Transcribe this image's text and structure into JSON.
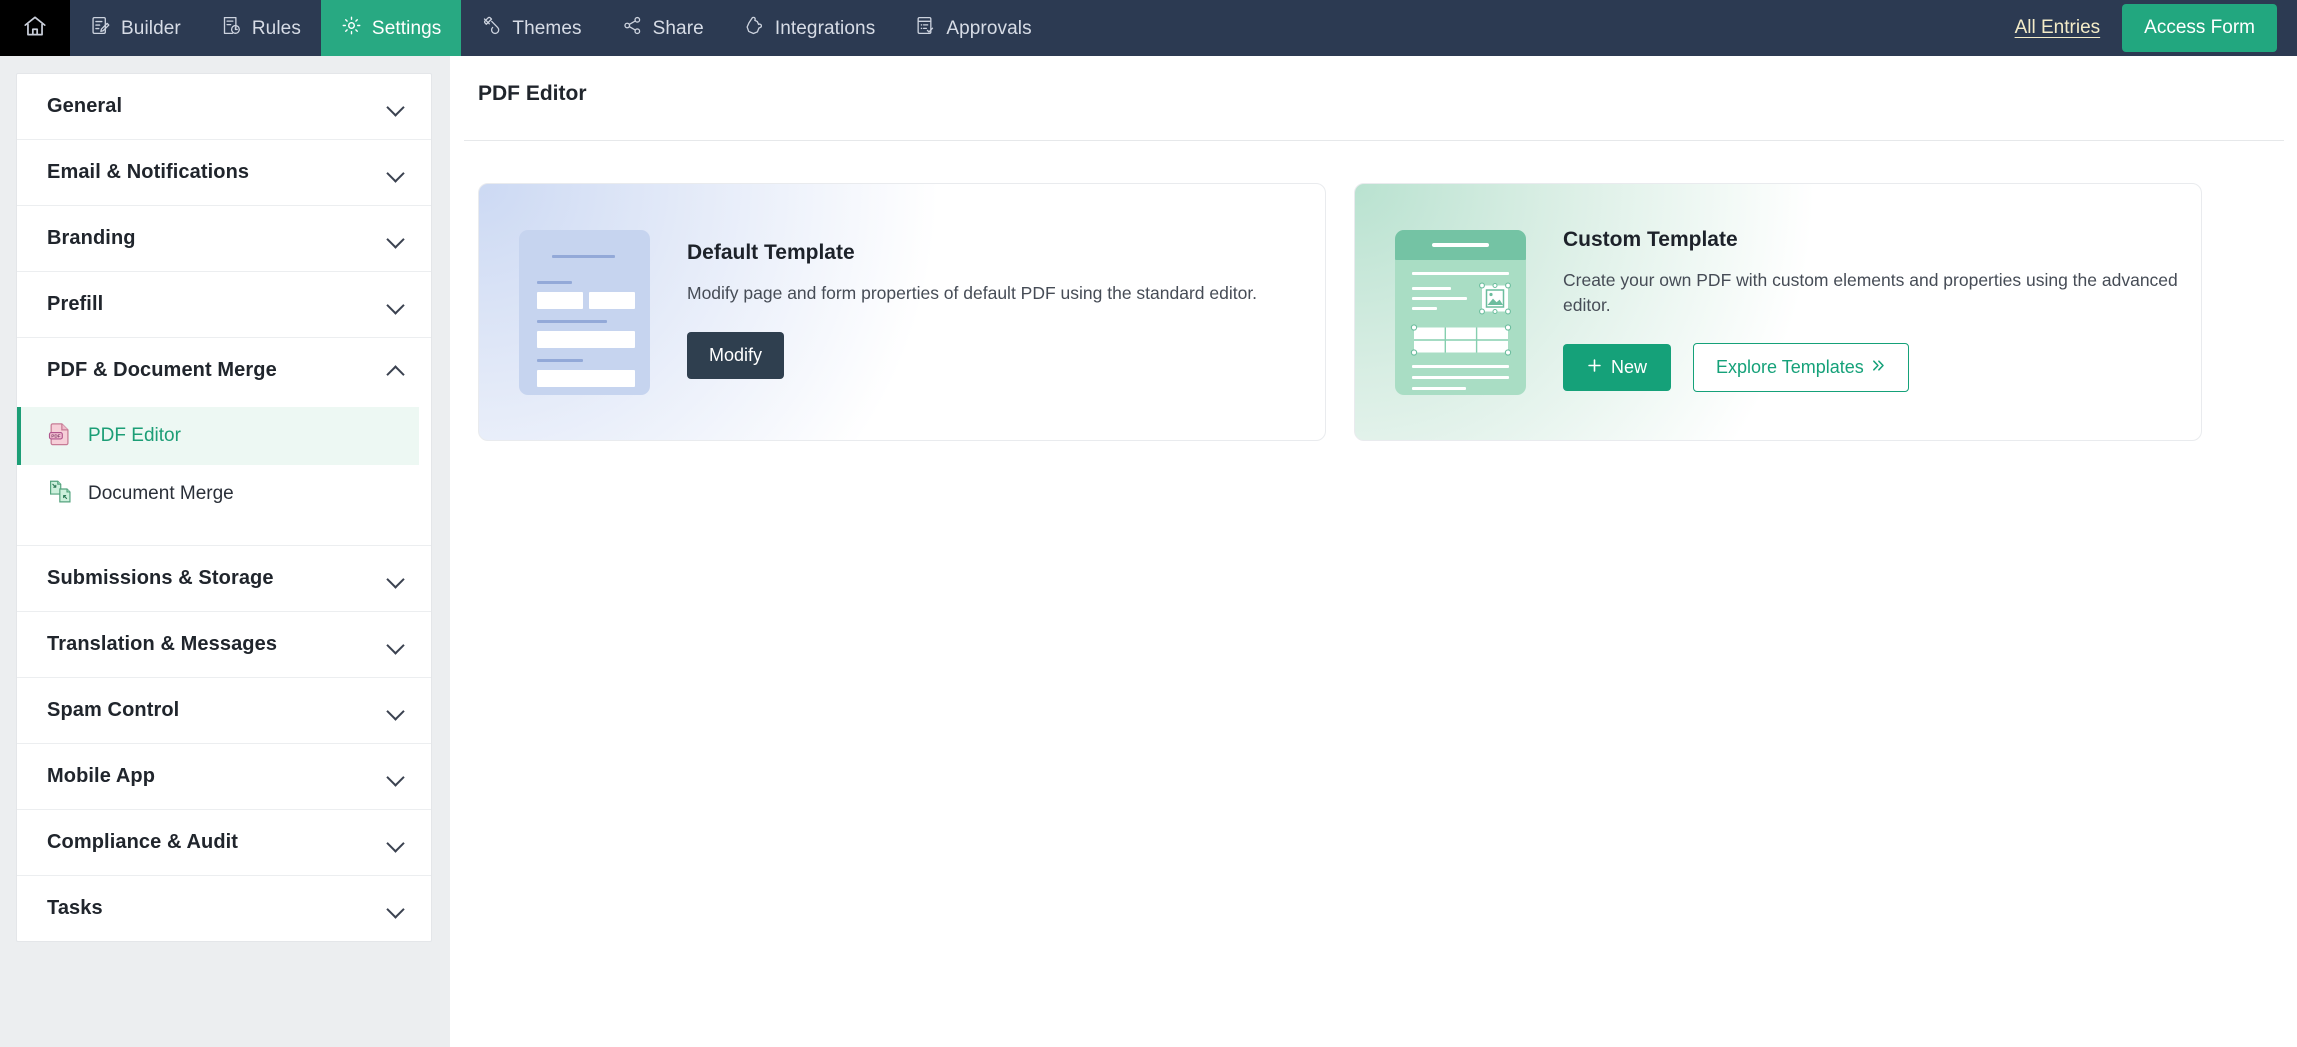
{
  "topnav": {
    "home_icon": "home-icon",
    "items": [
      {
        "label": "Builder",
        "icon": "form-builder-icon",
        "active": false
      },
      {
        "label": "Rules",
        "icon": "rules-document-icon",
        "active": false
      },
      {
        "label": "Settings",
        "icon": "gear-icon",
        "active": true
      },
      {
        "label": "Themes",
        "icon": "paint-roller-icon",
        "active": false
      },
      {
        "label": "Share",
        "icon": "share-nodes-icon",
        "active": false
      },
      {
        "label": "Integrations",
        "icon": "puzzle-piece-icon",
        "active": false
      },
      {
        "label": "Approvals",
        "icon": "document-check-icon",
        "active": false
      }
    ],
    "all_entries_label": "All Entries",
    "access_form_label": "Access Form",
    "active_color": "#28a982",
    "bg_color": "#2c3a52",
    "link_color": "#f4ecc8",
    "button_color": "#22a77f"
  },
  "sidebar": {
    "groups": [
      {
        "label": "General",
        "expanded": false
      },
      {
        "label": "Email & Notifications",
        "expanded": false
      },
      {
        "label": "Branding",
        "expanded": false
      },
      {
        "label": "Prefill",
        "expanded": false
      },
      {
        "label": "PDF & Document Merge",
        "expanded": true
      },
      {
        "label": "Submissions & Storage",
        "expanded": false
      },
      {
        "label": "Translation & Messages",
        "expanded": false
      },
      {
        "label": "Spam Control",
        "expanded": false
      },
      {
        "label": "Mobile App",
        "expanded": false
      },
      {
        "label": "Compliance & Audit",
        "expanded": false
      },
      {
        "label": "Tasks",
        "expanded": false
      }
    ],
    "pdf_submenu": [
      {
        "label": "PDF Editor",
        "icon": "pdf-file-icon",
        "active": true
      },
      {
        "label": "Document Merge",
        "icon": "merge-documents-icon",
        "active": false
      }
    ],
    "active_color": "#1c9e76",
    "active_bg": "#edf8f3"
  },
  "main": {
    "page_title": "PDF Editor",
    "cards": [
      {
        "title": "Default Template",
        "description": "Modify page and form properties of default PDF using the standard editor.",
        "thumbnail": "default-template-thumbnail",
        "accent": "#c6d4ef",
        "buttons": [
          {
            "label": "Modify",
            "style": "dark",
            "icon": ""
          }
        ]
      },
      {
        "title": "Custom Template",
        "description": "Create your own PDF with custom elements and properties using the advanced editor.",
        "thumbnail": "custom-template-thumbnail",
        "accent": "#a9ddc4",
        "buttons": [
          {
            "label": "New",
            "style": "green",
            "icon": "plus-icon"
          },
          {
            "label": "Explore Templates",
            "style": "outline",
            "icon": "double-chevron-right-icon"
          }
        ]
      }
    ]
  }
}
